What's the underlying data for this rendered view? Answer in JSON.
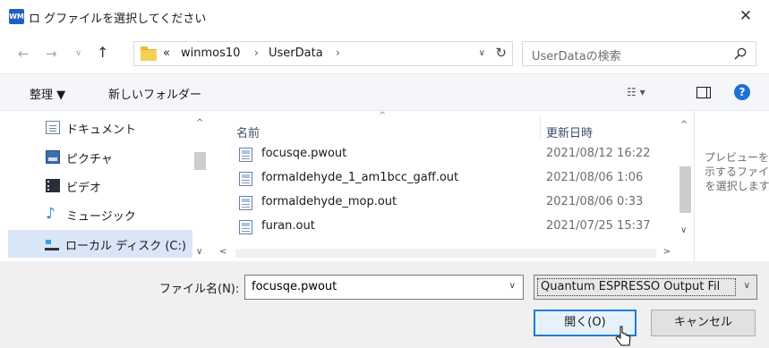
{
  "window": {
    "title": "ロ グファイルを選択してください",
    "app_icon_text": "WM",
    "close_glyph": "✕"
  },
  "navigation": {
    "back_glyph": "←",
    "forward_glyph": "→",
    "recent_glyph": "∨",
    "up_glyph": "↑",
    "address": {
      "overflow": "«",
      "crumbs": [
        "winmos10",
        "UserData"
      ],
      "separator": "›",
      "dropdown_glyph": "∨",
      "refresh_glyph": "↻"
    },
    "search": {
      "placeholder": "UserDataの検索"
    }
  },
  "toolbar": {
    "organize_label": "整理 ▼",
    "new_folder_label": "新しいフォルダー",
    "views_glyph": "☷ ▾",
    "help_glyph": "?"
  },
  "sidebar": {
    "items": [
      {
        "label": "ドキュメント",
        "icon": "documents-icon"
      },
      {
        "label": "ピクチャ",
        "icon": "pictures-icon"
      },
      {
        "label": "ビデオ",
        "icon": "videos-icon"
      },
      {
        "label": "ミュージック",
        "icon": "music-icon"
      },
      {
        "label": "ローカル ディスク (C:)",
        "icon": "local-disk-icon",
        "selected": true
      }
    ],
    "music_glyph": "♪"
  },
  "file_list": {
    "columns": {
      "name": "名前",
      "date": "更新日時"
    },
    "sort_glyph": "^",
    "files": [
      {
        "name": "focusqe.pwout",
        "date": "2021/08/12 16:22"
      },
      {
        "name": "formaldehyde_1_am1bcc_gaff.out",
        "date": "2021/08/06 1:06"
      },
      {
        "name": "formaldehyde_mop.out",
        "date": "2021/08/06 0:33"
      },
      {
        "name": "furan.out",
        "date": "2021/07/25 15:37"
      }
    ]
  },
  "scroll": {
    "up": "^",
    "down": "∨",
    "left": "<",
    "right": ">"
  },
  "preview": {
    "text": "プレビューを表示するファイルを選択します。"
  },
  "footer": {
    "filename_label": "ファイル名(N):",
    "filename_value": "focusqe.pwout",
    "filetype": "Quantum ESPRESSO Output Fil",
    "dropdown_glyph": "∨",
    "open_label": "開く(O)",
    "cancel_label": "キャンセル"
  }
}
